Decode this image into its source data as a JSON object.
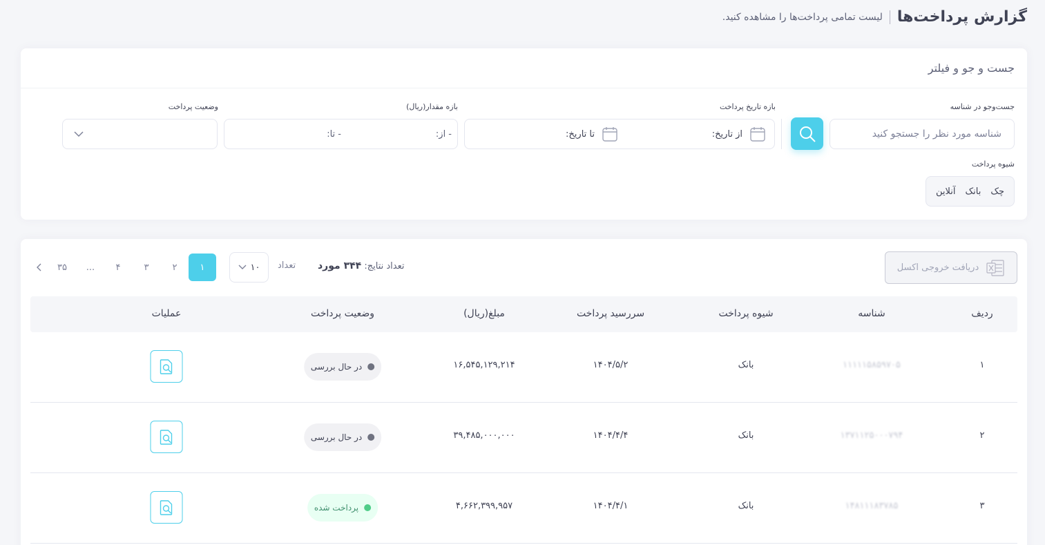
{
  "header": {
    "title": "گزارش پرداخت‌ها",
    "subtitle": "لیست تمامی پرداخت‌ها را مشاهده کنید."
  },
  "filter": {
    "title": "جست و جو و فیلتر",
    "search_label": "جست‌وجو در شناسه",
    "search_placeholder": "شناسه مورد نظر را جستجو کنید",
    "date_label": "بازه تاریخ پرداخت",
    "date_from": "از تاریخ:",
    "date_to": "تا تاریخ:",
    "amount_label": "بازه مقدار(ریال)",
    "amount_from": "- از:",
    "amount_to": "- تا:",
    "status_label": "وضعیت پرداخت",
    "method_label": "شیوه پرداخت",
    "methods": [
      "چک",
      "بانک",
      "آنلاین"
    ]
  },
  "results": {
    "excel_label": "دریافت خروجی اکسل",
    "count_label": "تعداد نتایج:",
    "count_value": "۳۴۴ مورد",
    "page_size_label": "تعداد",
    "page_size": "۱۰",
    "pages": [
      "۱",
      "۲",
      "۳",
      "۴",
      "...",
      "۳۵"
    ],
    "active_page": "۱"
  },
  "table": {
    "columns": [
      "ردیف",
      "شناسه",
      "شیوه پرداخت",
      "سررسید پرداخت",
      "مبلغ(ریال)",
      "وضعیت پرداخت",
      "عملیات"
    ],
    "rows": [
      {
        "index": "۱",
        "id": "۱۱۱۱۱۵۸۵۹۷۰۵",
        "method": "بانک",
        "due": "۱۴۰۴/۵/۲",
        "amount": "۱۶,۵۴۵,۱۲۹,۲۱۴",
        "status": "در حال بررسی",
        "status_type": "pending"
      },
      {
        "index": "۲",
        "id": "۱۳۷۱۱۲۵۰۰۰۷۹۴",
        "method": "بانک",
        "due": "۱۴۰۴/۴/۴",
        "amount": "۳۹,۴۸۵,۰۰۰,۰۰۰",
        "status": "در حال بررسی",
        "status_type": "pending"
      },
      {
        "index": "۳",
        "id": "۱۴۸۱۱۱۸۳۷۸۵",
        "method": "بانک",
        "due": "۱۴۰۴/۴/۱",
        "amount": "۴,۶۶۲,۳۹۹,۹۵۷",
        "status": "پرداخت شده",
        "status_type": "paid"
      }
    ]
  },
  "colors": {
    "accent": "#4dcfea",
    "paid": "#50cd89",
    "pending": "#6f7280"
  }
}
